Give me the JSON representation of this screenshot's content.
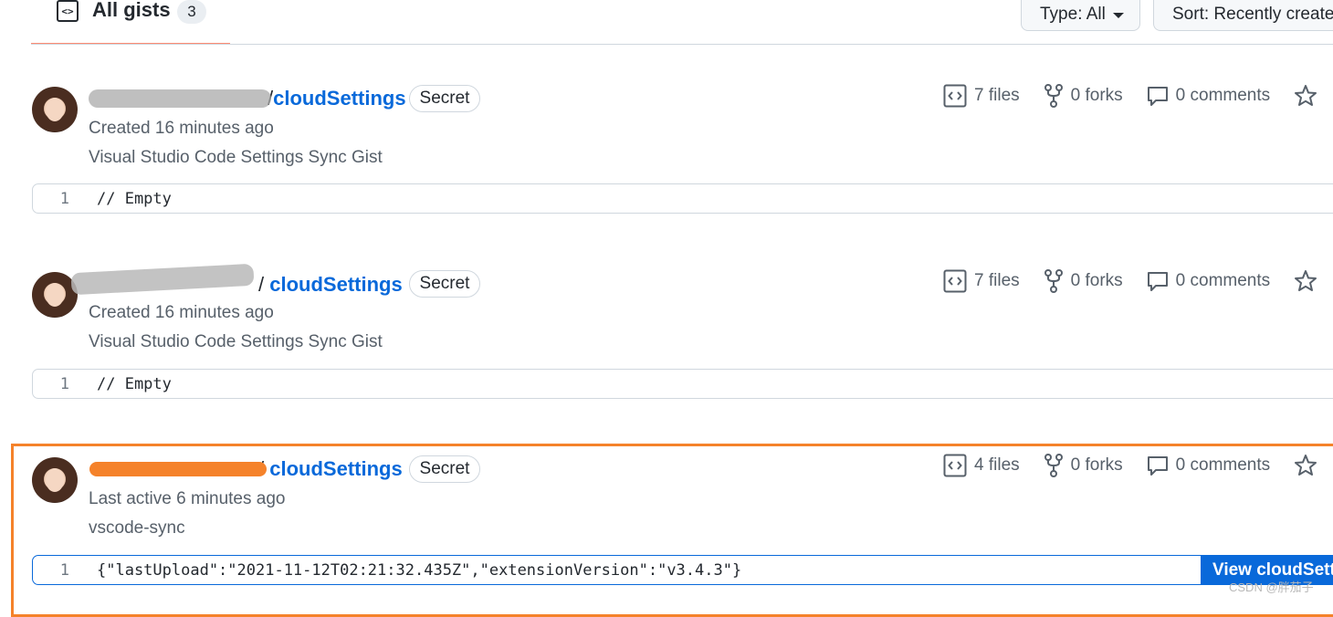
{
  "header": {
    "tab_label": "All gists",
    "tab_count": "3",
    "type_filter": "Type: All",
    "sort_filter": "Sort: Recently created"
  },
  "gists": [
    {
      "owner_separator": "/",
      "name": "cloudSettings",
      "badge": "Secret",
      "meta": "Created 16 minutes ago",
      "description": "Visual Studio Code Settings Sync Gist",
      "files": "7 files",
      "forks": "0 forks",
      "comments": "0 comments",
      "line_number": "1",
      "code": "// Empty"
    },
    {
      "owner_separator": "/",
      "name": "cloudSettings",
      "badge": "Secret",
      "meta": "Created 16 minutes ago",
      "description": "Visual Studio Code Settings Sync Gist",
      "files": "7 files",
      "forks": "0 forks",
      "comments": "0 comments",
      "line_number": "1",
      "code": "// Empty"
    },
    {
      "owner_separator": "/",
      "name": "cloudSettings",
      "badge": "Secret",
      "meta": "Last active 6 minutes ago",
      "description": "vscode-sync",
      "files": "4 files",
      "forks": "0 forks",
      "comments": "0 comments",
      "line_number": "1",
      "code": "{\"lastUpload\":\"2021-11-12T02:21:32.435Z\",\"extensionVersion\":\"v3.4.3\"}",
      "view_button": "View cloudSettings"
    }
  ],
  "watermark": "CSDN @胖茄子",
  "colors": {
    "link": "#0969da",
    "highlight": "#f5822a",
    "tab_underline": "#fd8c73"
  }
}
